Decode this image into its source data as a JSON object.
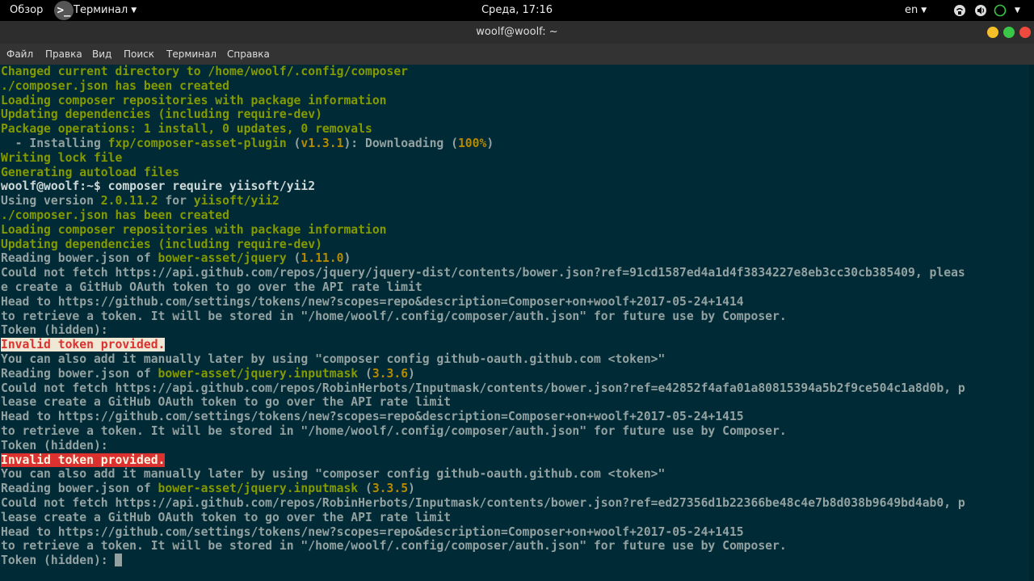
{
  "topbar": {
    "overview": "Обзор",
    "app_icon_glyph": ">_",
    "app_menu": "Терминал",
    "clock": "Среда, 17:16",
    "lang": "en",
    "caret": "▼"
  },
  "window": {
    "title": "woolf@woolf: ~"
  },
  "menubar": {
    "items": [
      "Файл",
      "Правка",
      "Вид",
      "Поиск",
      "Терминал",
      "Справка"
    ]
  },
  "terminal": {
    "lines": [
      [
        {
          "t": "Changed current directory to /home/woolf/.config/composer",
          "c": "g"
        }
      ],
      [
        {
          "t": "./composer.json has been created",
          "c": "g"
        }
      ],
      [
        {
          "t": "Loading composer repositories with package information",
          "c": "g"
        }
      ],
      [
        {
          "t": "Updating dependencies (including require-dev)",
          "c": "g"
        }
      ],
      [
        {
          "t": "Package operations: 1 install, 0 updates, 0 removals",
          "c": "g"
        }
      ],
      [
        {
          "t": "  - Installing ",
          "c": ""
        },
        {
          "t": "fxp/composer-asset-plugin",
          "c": "g"
        },
        {
          "t": " (",
          "c": ""
        },
        {
          "t": "v1.3.1",
          "c": "y"
        },
        {
          "t": "): Downloading (",
          "c": ""
        },
        {
          "t": "100%",
          "c": "y"
        },
        {
          "t": ")",
          "c": ""
        }
      ],
      [
        {
          "t": "Writing lock file",
          "c": "g"
        }
      ],
      [
        {
          "t": "Generating autoload files",
          "c": "g"
        }
      ],
      [
        {
          "t": "woolf@woolf:~$ composer require yiisoft/yii2",
          "c": "w"
        }
      ],
      [
        {
          "t": "Using version ",
          "c": ""
        },
        {
          "t": "2.0.11.2",
          "c": "g"
        },
        {
          "t": " for ",
          "c": ""
        },
        {
          "t": "yiisoft/yii2",
          "c": "g"
        }
      ],
      [
        {
          "t": "./composer.json has been created",
          "c": "g"
        }
      ],
      [
        {
          "t": "Loading composer repositories with package information",
          "c": "g"
        }
      ],
      [
        {
          "t": "Updating dependencies (including require-dev)",
          "c": "g"
        }
      ],
      [
        {
          "t": "Reading bower.json of ",
          "c": ""
        },
        {
          "t": "bower-asset/jquery",
          "c": "g"
        },
        {
          "t": " (",
          "c": ""
        },
        {
          "t": "1.11.0",
          "c": "y"
        },
        {
          "t": ")",
          "c": ""
        }
      ],
      [
        {
          "t": "Could not fetch https://api.github.com/repos/jquery/jquery-dist/contents/bower.json?ref=91cd1587ed4a1d4f3834227e8eb3cc30cb385409, pleas",
          "c": ""
        }
      ],
      [
        {
          "t": "e create a GitHub OAuth token to go over the API rate limit",
          "c": ""
        }
      ],
      [
        {
          "t": "Head to https://github.com/settings/tokens/new?scopes=repo&description=Composer+on+woolf+2017-05-24+1414",
          "c": ""
        }
      ],
      [
        {
          "t": "to retrieve a token. It will be stored in \"/home/woolf/.config/composer/auth.json\" for future use by Composer.",
          "c": ""
        }
      ],
      [
        {
          "t": "Token (hidden):",
          "c": ""
        }
      ],
      [
        {
          "t": "Invalid token provided.",
          "c": "err-white"
        }
      ],
      [
        {
          "t": "You can also add it manually later by using \"composer config github-oauth.github.com <token>\"",
          "c": ""
        }
      ],
      [
        {
          "t": "Reading bower.json of ",
          "c": ""
        },
        {
          "t": "bower-asset/jquery.inputmask",
          "c": "g"
        },
        {
          "t": " (",
          "c": ""
        },
        {
          "t": "3.3.6",
          "c": "y"
        },
        {
          "t": ")",
          "c": ""
        }
      ],
      [
        {
          "t": "Could not fetch https://api.github.com/repos/RobinHerbots/Inputmask/contents/bower.json?ref=e42852f4afa01a80815394a5b2f9ce504c1a8d0b, p",
          "c": ""
        }
      ],
      [
        {
          "t": "lease create a GitHub OAuth token to go over the API rate limit",
          "c": ""
        }
      ],
      [
        {
          "t": "Head to https://github.com/settings/tokens/new?scopes=repo&description=Composer+on+woolf+2017-05-24+1415",
          "c": ""
        }
      ],
      [
        {
          "t": "to retrieve a token. It will be stored in \"/home/woolf/.config/composer/auth.json\" for future use by Composer.",
          "c": ""
        }
      ],
      [
        {
          "t": "Token (hidden):",
          "c": ""
        }
      ],
      [
        {
          "t": "Invalid token provided.",
          "c": "err-red"
        }
      ],
      [
        {
          "t": "You can also add it manually later by using \"composer config github-oauth.github.com <token>\"",
          "c": ""
        }
      ],
      [
        {
          "t": "Reading bower.json of ",
          "c": ""
        },
        {
          "t": "bower-asset/jquery.inputmask",
          "c": "g"
        },
        {
          "t": " (",
          "c": ""
        },
        {
          "t": "3.3.5",
          "c": "y"
        },
        {
          "t": ")",
          "c": ""
        }
      ],
      [
        {
          "t": "Could not fetch https://api.github.com/repos/RobinHerbots/Inputmask/contents/bower.json?ref=ed27356d1b22366be48c4e7b8d038b9649bd4ab0, p",
          "c": ""
        }
      ],
      [
        {
          "t": "lease create a GitHub OAuth token to go over the API rate limit",
          "c": ""
        }
      ],
      [
        {
          "t": "Head to https://github.com/settings/tokens/new?scopes=repo&description=Composer+on+woolf+2017-05-24+1415",
          "c": ""
        }
      ],
      [
        {
          "t": "to retrieve a token. It will be stored in \"/home/woolf/.config/composer/auth.json\" for future use by Composer.",
          "c": ""
        }
      ],
      [
        {
          "t": "Token (hidden): ",
          "c": ""
        }
      ]
    ]
  },
  "colors": {
    "terminal_bg": "#002b36",
    "fg": "#93a1a1",
    "green": "#859900",
    "yellow": "#b58900",
    "red": "#dc322f"
  },
  "icons": [
    "terminal-icon",
    "network-icon",
    "volume-icon",
    "power-icon"
  ]
}
